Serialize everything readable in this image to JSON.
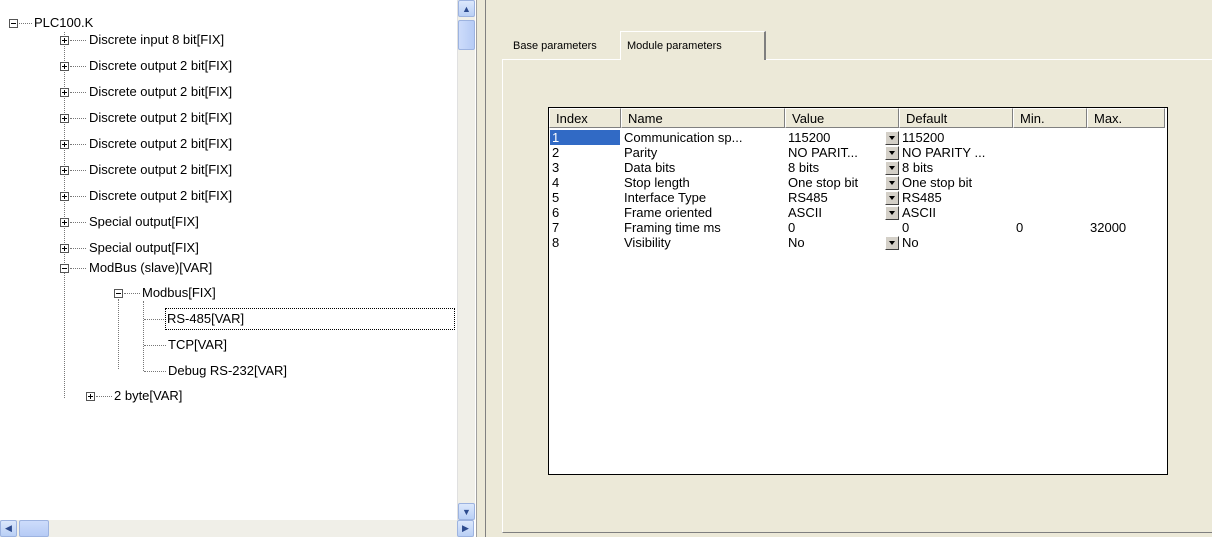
{
  "tree": {
    "root": "PLC100.K",
    "nodes": [
      {
        "label": "Discrete input 8 bit[FIX]",
        "expander": "plus"
      },
      {
        "label": "Discrete output 2 bit[FIX]",
        "expander": "plus"
      },
      {
        "label": "Discrete output 2 bit[FIX]",
        "expander": "plus"
      },
      {
        "label": "Discrete output 2 bit[FIX]",
        "expander": "plus"
      },
      {
        "label": "Discrete output 2 bit[FIX]",
        "expander": "plus"
      },
      {
        "label": "Discrete output 2 bit[FIX]",
        "expander": "plus"
      },
      {
        "label": "Discrete output 2 bit[FIX]",
        "expander": "plus"
      },
      {
        "label": "Special output[FIX]",
        "expander": "plus"
      },
      {
        "label": "ModBus (slave)[VAR]",
        "expander": "minus"
      },
      {
        "label": "Modbus[FIX]",
        "expander": "minus"
      },
      {
        "label": "RS-485[VAR]",
        "selected": true
      },
      {
        "label": "TCP[VAR]"
      },
      {
        "label": "Debug RS-232[VAR]"
      },
      {
        "label": "2 byte[VAR]",
        "expander": "plus"
      }
    ]
  },
  "tabs": [
    {
      "label": "Base parameters",
      "active": false
    },
    {
      "label": "Module parameters",
      "active": true
    }
  ],
  "grid": {
    "columns": [
      "Index",
      "Name",
      "Value",
      "Default",
      "Min.",
      "Max."
    ],
    "rows": [
      {
        "index": "1",
        "name": "Communication sp...",
        "value": "115200",
        "default": "115200",
        "min": "",
        "max": "",
        "dropdown": true,
        "selected": true
      },
      {
        "index": "2",
        "name": "Parity",
        "value": "NO PARIT...",
        "default": "NO PARITY ...",
        "min": "",
        "max": "",
        "dropdown": true
      },
      {
        "index": "3",
        "name": "Data bits",
        "value": "8 bits",
        "default": "8 bits",
        "min": "",
        "max": "",
        "dropdown": true
      },
      {
        "index": "4",
        "name": "Stop length",
        "value": "One stop bit",
        "default": "One stop bit",
        "min": "",
        "max": "",
        "dropdown": true
      },
      {
        "index": "5",
        "name": "Interface Type",
        "value": "RS485",
        "default": "RS485",
        "min": "",
        "max": "",
        "dropdown": true
      },
      {
        "index": "6",
        "name": "Frame oriented",
        "value": "ASCII",
        "default": "ASCII",
        "min": "",
        "max": "",
        "dropdown": true
      },
      {
        "index": "7",
        "name": "Framing time ms",
        "value": "0",
        "default": "0",
        "min": "0",
        "max": "32000",
        "dropdown": false
      },
      {
        "index": "8",
        "name": "Visibility",
        "value": "No",
        "default": "No",
        "min": "",
        "max": "",
        "dropdown": true
      }
    ]
  },
  "icons": {
    "scroll_up": "scroll-up-icon",
    "scroll_down": "scroll-down-icon",
    "scroll_left": "scroll-left-icon",
    "scroll_right": "scroll-right-icon"
  },
  "colors": {
    "selection": "#316ac5",
    "panel": "#ece9d8",
    "scroll_button": "#b9cff5"
  }
}
